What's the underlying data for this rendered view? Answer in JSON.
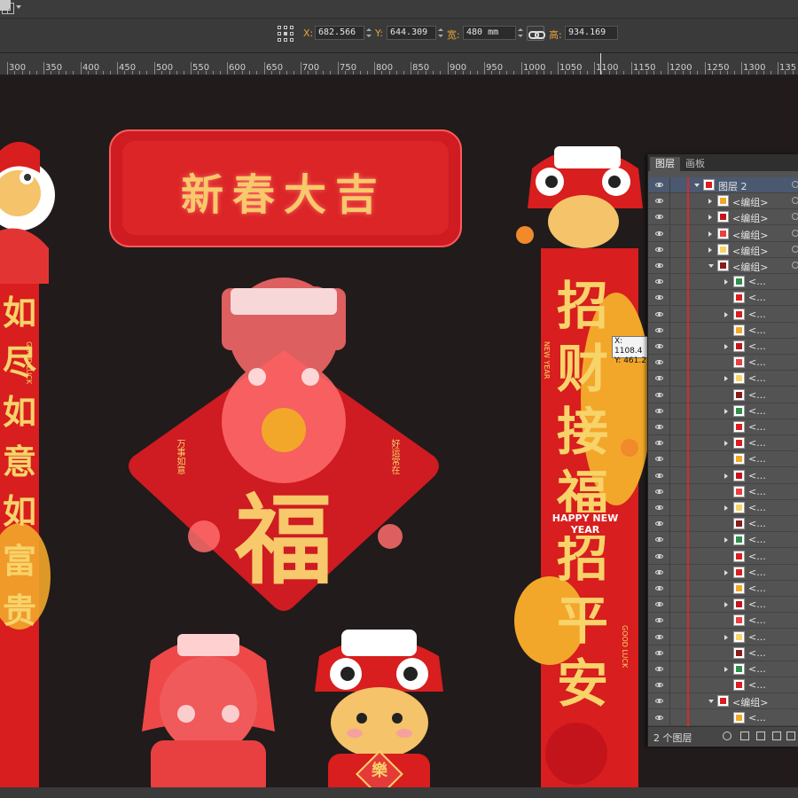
{
  "controls": {
    "x_label": "X:",
    "x_value": "682.566",
    "y_label": "Y:",
    "y_value": "644.309",
    "w_label": "宽:",
    "w_value": "480 mm",
    "h_label": "高:",
    "h_value": "934.169"
  },
  "ruler": {
    "marks": [
      "300",
      "350",
      "400",
      "450",
      "500",
      "550",
      "600",
      "650",
      "700",
      "750",
      "800",
      "850",
      "900",
      "950",
      "1000",
      "1050",
      "1100",
      "1150",
      "1200",
      "1250",
      "1300",
      "135"
    ]
  },
  "artwork": {
    "banner_text": "新春大吉",
    "fu_char": "福",
    "fu_left_small": "万事如意",
    "fu_right_small": "好运常在",
    "right_couplet": [
      "招",
      "财",
      "接",
      "福",
      "招",
      "平",
      "安"
    ],
    "left_couplet": [
      "如",
      "尽",
      "如",
      "意",
      "如",
      "富",
      "贵"
    ],
    "happy_new_year": "HAPPY NEW YEAR",
    "new_year_side": "NEW YEAR",
    "good_luck": "GOOD LUCK",
    "lucky_char": "樂"
  },
  "tooltip": {
    "x": "X: 1108.4",
    "y": "Y: 461.2"
  },
  "layers_panel": {
    "tabs": [
      "图层",
      "画板"
    ],
    "rows": [
      {
        "label": "图层 2",
        "kind": "layer",
        "expanded": true
      },
      {
        "label": "<编组>",
        "kind": "group"
      },
      {
        "label": "<编组>",
        "kind": "group"
      },
      {
        "label": "<编组>",
        "kind": "group"
      },
      {
        "label": "<编组>",
        "kind": "group"
      },
      {
        "label": "<编组>",
        "kind": "group-open"
      },
      {
        "label": "<...",
        "kind": "item"
      },
      {
        "label": "<...",
        "kind": "item"
      },
      {
        "label": "<...",
        "kind": "item"
      },
      {
        "label": "<...",
        "kind": "item"
      },
      {
        "label": "<...",
        "kind": "item"
      },
      {
        "label": "<...",
        "kind": "item"
      },
      {
        "label": "<...",
        "kind": "item"
      },
      {
        "label": "<...",
        "kind": "item"
      },
      {
        "label": "<...",
        "kind": "item"
      },
      {
        "label": "<...",
        "kind": "item"
      },
      {
        "label": "<...",
        "kind": "item"
      },
      {
        "label": "<...",
        "kind": "item"
      },
      {
        "label": "<...",
        "kind": "item"
      },
      {
        "label": "<...",
        "kind": "item"
      },
      {
        "label": "<...",
        "kind": "item"
      },
      {
        "label": "<...",
        "kind": "item"
      },
      {
        "label": "<...",
        "kind": "item"
      },
      {
        "label": "<...",
        "kind": "item"
      },
      {
        "label": "<...",
        "kind": "item"
      },
      {
        "label": "<...",
        "kind": "item"
      },
      {
        "label": "<...",
        "kind": "item"
      },
      {
        "label": "<...",
        "kind": "item"
      },
      {
        "label": "<...",
        "kind": "item"
      },
      {
        "label": "<...",
        "kind": "item"
      },
      {
        "label": "<...",
        "kind": "item"
      },
      {
        "label": "<...",
        "kind": "item"
      },
      {
        "label": "<编组>",
        "kind": "group-open"
      },
      {
        "label": "<...",
        "kind": "item"
      }
    ],
    "footer": "2 个图层"
  }
}
